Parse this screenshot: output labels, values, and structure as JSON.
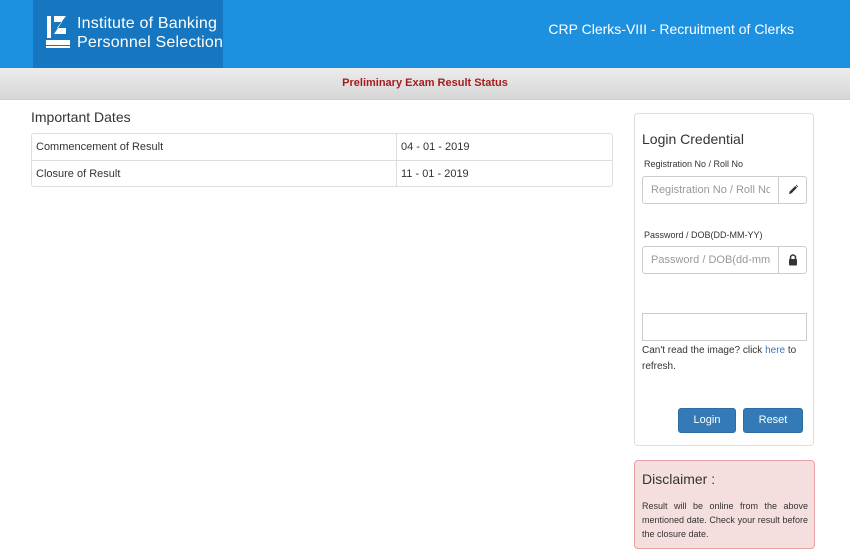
{
  "header": {
    "logo_lines": [
      "Institute of Banking",
      "Personnel Selection"
    ],
    "logo_icon": "ibps-logo-icon",
    "title": "CRP Clerks-VIII - Recruitment of Clerks",
    "color": "#1d91e0"
  },
  "subbar": {
    "title": "Preliminary Exam Result Status",
    "color": "#a61c1c"
  },
  "important_dates": {
    "heading": "Important Dates",
    "rows": [
      {
        "label": "Commencement of Result",
        "value": "04 - 01 - 2019"
      },
      {
        "label": "Closure of Result",
        "value": "11 - 01 - 2019"
      }
    ]
  },
  "login": {
    "title": "Login Credential",
    "registration": {
      "label": "Registration No / Roll No",
      "placeholder": "Registration No / Roll No",
      "value": "",
      "icon": "pencil-icon"
    },
    "password": {
      "label": "Password / DOB(DD-MM-YY)",
      "placeholder": "Password / DOB(dd-mm-yy)",
      "value": "",
      "icon": "lock-icon"
    },
    "captcha": {
      "value": "",
      "text_before": "Can't read the image? click ",
      "link_text": "here",
      "text_after": " to refresh."
    },
    "login_button": "Login",
    "reset_button": "Reset",
    "button_color": "#337ab7"
  },
  "disclaimer": {
    "title": "Disclaimer :",
    "text": "Result will be online from the above mentioned date. Check your result before the closure date.",
    "color": "#f5dede"
  }
}
